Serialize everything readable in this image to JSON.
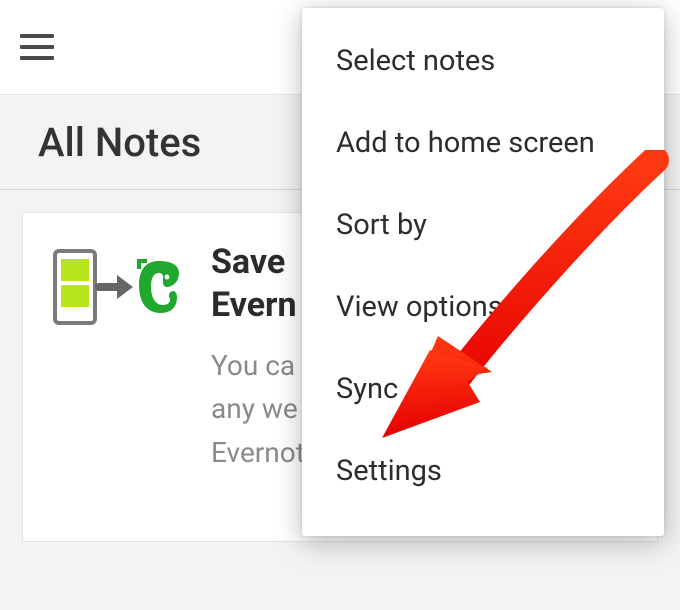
{
  "header": {
    "page_title": "All Notes"
  },
  "card": {
    "title_line1": "Save",
    "title_line2": "Evern",
    "body_line1": "You ca",
    "body_line2": "any we",
    "body_line3": "Evernot"
  },
  "menu": {
    "items": [
      "Select notes",
      "Add to home screen",
      "Sort by",
      "View options",
      "Sync",
      "Settings"
    ]
  },
  "annotation": {
    "arrow_color": "#ff1a00",
    "target_item": "Sync"
  }
}
